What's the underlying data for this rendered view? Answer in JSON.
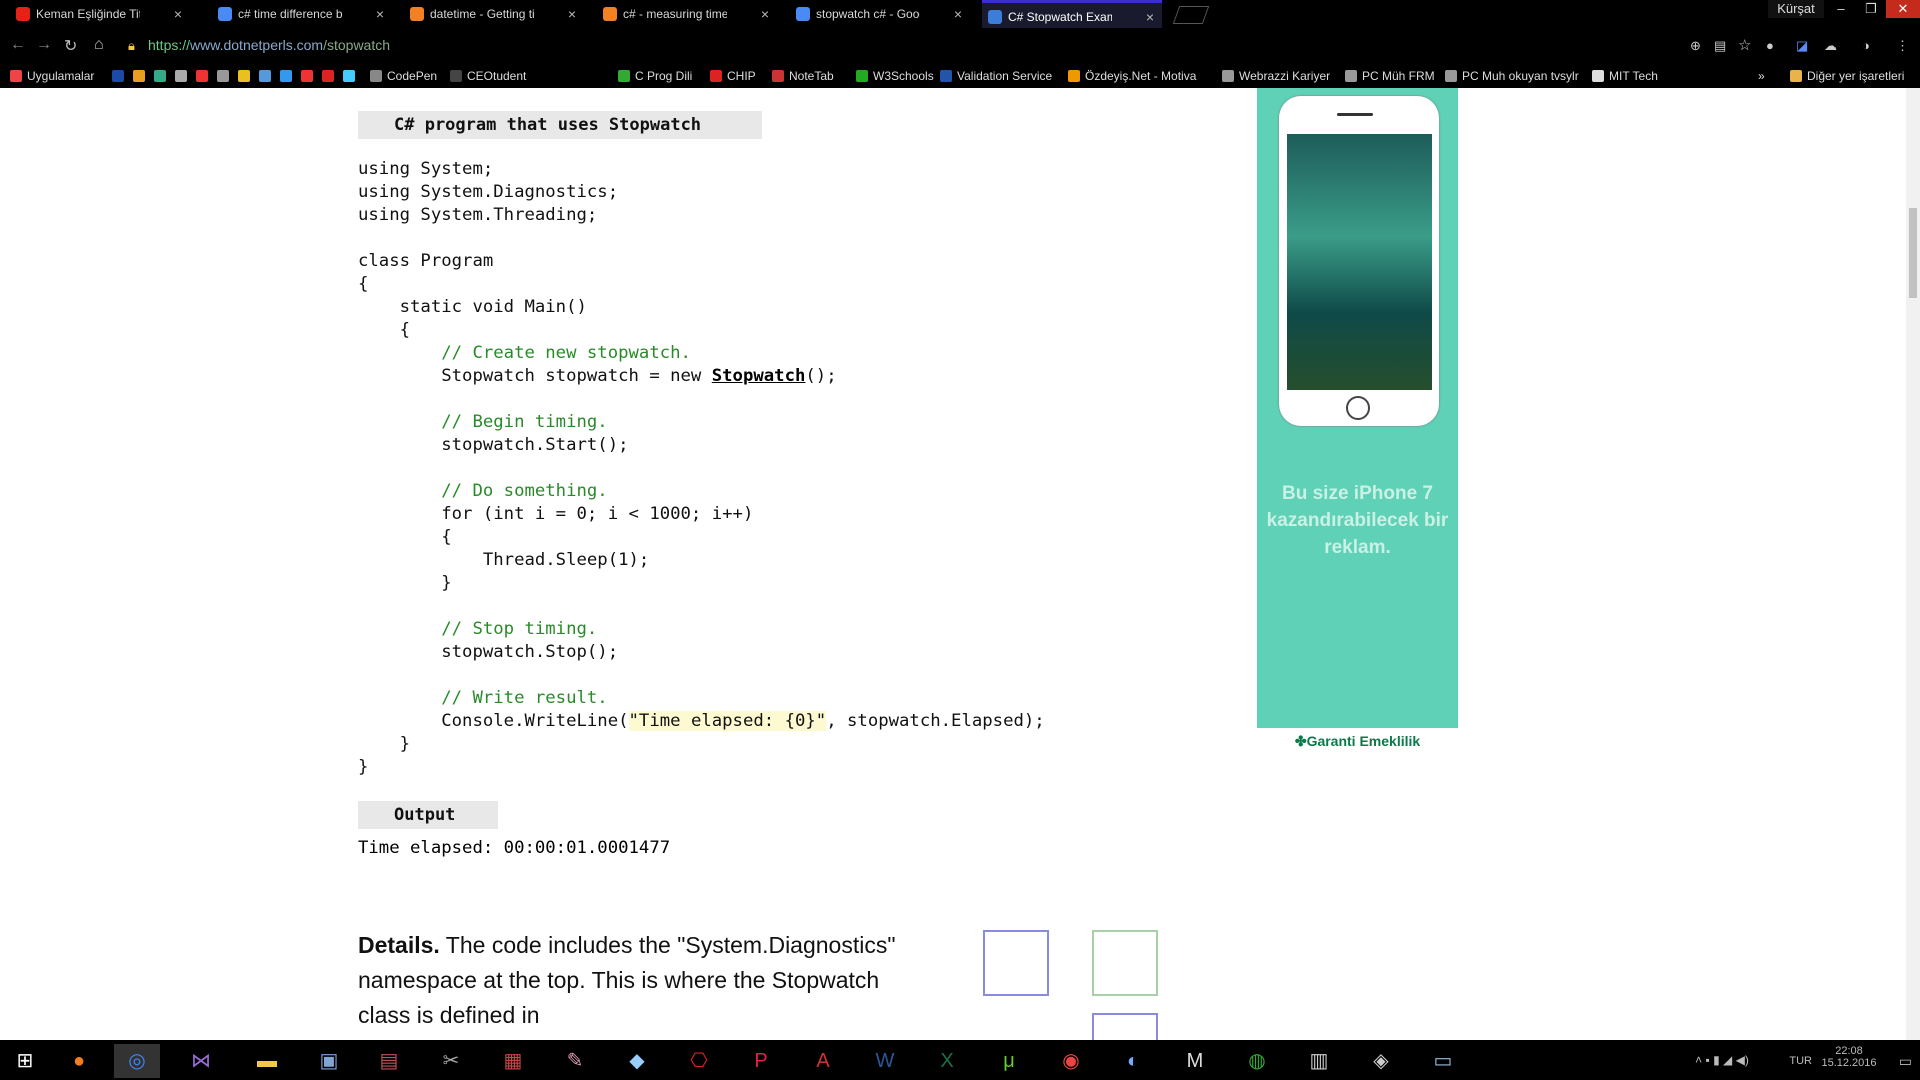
{
  "tabs": [
    {
      "label": "Keman Eşliğinde Titanic",
      "color": "#e62117"
    },
    {
      "label": "c# time difference betwe",
      "color": "#4a8af4"
    },
    {
      "label": "datetime - Getting time",
      "color": "#f48024"
    },
    {
      "label": "c# - measuring time acr",
      "color": "#f48024"
    },
    {
      "label": "stopwatch c# - Google'd",
      "color": "#4a8af4"
    },
    {
      "label": "C# Stopwatch Examples",
      "color": "#3b7dd8"
    }
  ],
  "window": {
    "user": "Kürşat"
  },
  "address": {
    "scheme": "https://",
    "host": "www.dotnetperls.com",
    "path": "/stopwatch"
  },
  "bookmarks": [
    {
      "label": "Uygulamalar",
      "color": "#e44"
    },
    {
      "label": "CodePen",
      "color": "#888"
    },
    {
      "label": "CEOtudent",
      "color": "#444"
    },
    {
      "label": "C Prog Dili",
      "color": "#3a3"
    },
    {
      "label": "CHIP",
      "color": "#d22"
    },
    {
      "label": "NoteTab",
      "color": "#c33"
    },
    {
      "label": "W3Schools",
      "color": "#2a2"
    },
    {
      "label": "Validation Service",
      "color": "#25a"
    },
    {
      "label": "Özdeyiş.Net - Motiva",
      "color": "#e90"
    },
    {
      "label": "Webrazzi Kariyer",
      "color": "#999"
    },
    {
      "label": "PC Müh FRM",
      "color": "#999"
    },
    {
      "label": "PC Muh okuyan tvsylr",
      "color": "#999"
    },
    {
      "label": "MIT Tech",
      "color": "#ddd"
    },
    {
      "label": "Diğer yer işaretleri",
      "color": "#e9b34a"
    }
  ],
  "page": {
    "code_header": "C# program that uses Stopwatch",
    "code_lines": [
      {
        "t": "using System;"
      },
      {
        "t": "using System.Diagnostics;"
      },
      {
        "t": "using System.Threading;"
      },
      {
        "t": ""
      },
      {
        "t": "class Program"
      },
      {
        "t": "{"
      },
      {
        "t": "    static void Main()"
      },
      {
        "t": "    {"
      },
      {
        "t": "        // Create new stopwatch.",
        "cls": "cm"
      },
      {
        "t": "        Stopwatch stopwatch = new ",
        "link": "Stopwatch",
        "after": "();"
      },
      {
        "t": ""
      },
      {
        "t": "        // Begin timing.",
        "cls": "cm"
      },
      {
        "t": "        stopwatch.Start();"
      },
      {
        "t": ""
      },
      {
        "t": "        // Do something.",
        "cls": "cm"
      },
      {
        "t": "        for (int i = 0; i < 1000; i++)"
      },
      {
        "t": "        {"
      },
      {
        "t": "            Thread.Sleep(1);"
      },
      {
        "t": "        }"
      },
      {
        "t": ""
      },
      {
        "t": "        // Stop timing.",
        "cls": "cm"
      },
      {
        "t": "        stopwatch.Stop();"
      },
      {
        "t": ""
      },
      {
        "t": "        // Write result.",
        "cls": "cm"
      },
      {
        "t": "        Console.WriteLine(",
        "str": "\"Time elapsed: {0}\"",
        "after": ", stopwatch.Elapsed);"
      },
      {
        "t": "    }"
      },
      {
        "t": "}"
      }
    ],
    "output_header": "Output",
    "output_text": "Time elapsed: 00:00:01.0001477",
    "details_bold": "Details.",
    "details_text": " The code includes the \"System.Diagnostics\" namespace at the top. This is where the Stopwatch class is defined in"
  },
  "ad": {
    "text": "Bu size iPhone 7 kazandırabilecek bir reklam.",
    "footer": "Garanti Emeklilik"
  },
  "taskbar": {
    "lang": "TUR",
    "time": "22:08",
    "date": "15.12.2016"
  }
}
